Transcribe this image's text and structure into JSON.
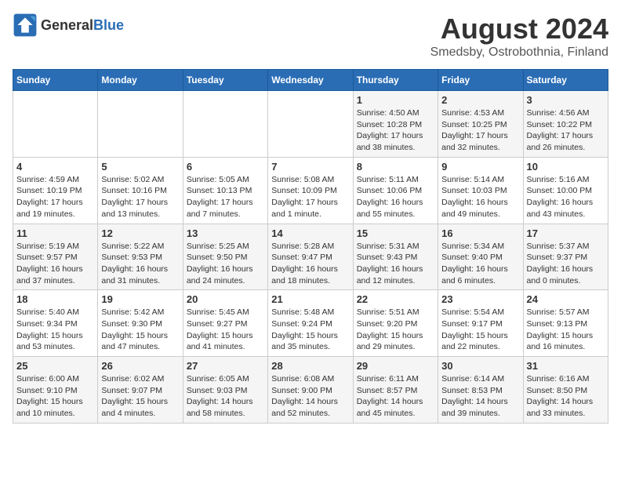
{
  "header": {
    "logo_general": "General",
    "logo_blue": "Blue",
    "title": "August 2024",
    "subtitle": "Smedsby, Ostrobothnia, Finland"
  },
  "days_of_week": [
    "Sunday",
    "Monday",
    "Tuesday",
    "Wednesday",
    "Thursday",
    "Friday",
    "Saturday"
  ],
  "weeks": [
    [
      {
        "day": "",
        "sunrise": "",
        "sunset": "",
        "daylight": ""
      },
      {
        "day": "",
        "sunrise": "",
        "sunset": "",
        "daylight": ""
      },
      {
        "day": "",
        "sunrise": "",
        "sunset": "",
        "daylight": ""
      },
      {
        "day": "",
        "sunrise": "",
        "sunset": "",
        "daylight": ""
      },
      {
        "day": "1",
        "sunrise": "Sunrise: 4:50 AM",
        "sunset": "Sunset: 10:28 PM",
        "daylight": "Daylight: 17 hours and 38 minutes."
      },
      {
        "day": "2",
        "sunrise": "Sunrise: 4:53 AM",
        "sunset": "Sunset: 10:25 PM",
        "daylight": "Daylight: 17 hours and 32 minutes."
      },
      {
        "day": "3",
        "sunrise": "Sunrise: 4:56 AM",
        "sunset": "Sunset: 10:22 PM",
        "daylight": "Daylight: 17 hours and 26 minutes."
      }
    ],
    [
      {
        "day": "4",
        "sunrise": "Sunrise: 4:59 AM",
        "sunset": "Sunset: 10:19 PM",
        "daylight": "Daylight: 17 hours and 19 minutes."
      },
      {
        "day": "5",
        "sunrise": "Sunrise: 5:02 AM",
        "sunset": "Sunset: 10:16 PM",
        "daylight": "Daylight: 17 hours and 13 minutes."
      },
      {
        "day": "6",
        "sunrise": "Sunrise: 5:05 AM",
        "sunset": "Sunset: 10:13 PM",
        "daylight": "Daylight: 17 hours and 7 minutes."
      },
      {
        "day": "7",
        "sunrise": "Sunrise: 5:08 AM",
        "sunset": "Sunset: 10:09 PM",
        "daylight": "Daylight: 17 hours and 1 minute."
      },
      {
        "day": "8",
        "sunrise": "Sunrise: 5:11 AM",
        "sunset": "Sunset: 10:06 PM",
        "daylight": "Daylight: 16 hours and 55 minutes."
      },
      {
        "day": "9",
        "sunrise": "Sunrise: 5:14 AM",
        "sunset": "Sunset: 10:03 PM",
        "daylight": "Daylight: 16 hours and 49 minutes."
      },
      {
        "day": "10",
        "sunrise": "Sunrise: 5:16 AM",
        "sunset": "Sunset: 10:00 PM",
        "daylight": "Daylight: 16 hours and 43 minutes."
      }
    ],
    [
      {
        "day": "11",
        "sunrise": "Sunrise: 5:19 AM",
        "sunset": "Sunset: 9:57 PM",
        "daylight": "Daylight: 16 hours and 37 minutes."
      },
      {
        "day": "12",
        "sunrise": "Sunrise: 5:22 AM",
        "sunset": "Sunset: 9:53 PM",
        "daylight": "Daylight: 16 hours and 31 minutes."
      },
      {
        "day": "13",
        "sunrise": "Sunrise: 5:25 AM",
        "sunset": "Sunset: 9:50 PM",
        "daylight": "Daylight: 16 hours and 24 minutes."
      },
      {
        "day": "14",
        "sunrise": "Sunrise: 5:28 AM",
        "sunset": "Sunset: 9:47 PM",
        "daylight": "Daylight: 16 hours and 18 minutes."
      },
      {
        "day": "15",
        "sunrise": "Sunrise: 5:31 AM",
        "sunset": "Sunset: 9:43 PM",
        "daylight": "Daylight: 16 hours and 12 minutes."
      },
      {
        "day": "16",
        "sunrise": "Sunrise: 5:34 AM",
        "sunset": "Sunset: 9:40 PM",
        "daylight": "Daylight: 16 hours and 6 minutes."
      },
      {
        "day": "17",
        "sunrise": "Sunrise: 5:37 AM",
        "sunset": "Sunset: 9:37 PM",
        "daylight": "Daylight: 16 hours and 0 minutes."
      }
    ],
    [
      {
        "day": "18",
        "sunrise": "Sunrise: 5:40 AM",
        "sunset": "Sunset: 9:34 PM",
        "daylight": "Daylight: 15 hours and 53 minutes."
      },
      {
        "day": "19",
        "sunrise": "Sunrise: 5:42 AM",
        "sunset": "Sunset: 9:30 PM",
        "daylight": "Daylight: 15 hours and 47 minutes."
      },
      {
        "day": "20",
        "sunrise": "Sunrise: 5:45 AM",
        "sunset": "Sunset: 9:27 PM",
        "daylight": "Daylight: 15 hours and 41 minutes."
      },
      {
        "day": "21",
        "sunrise": "Sunrise: 5:48 AM",
        "sunset": "Sunset: 9:24 PM",
        "daylight": "Daylight: 15 hours and 35 minutes."
      },
      {
        "day": "22",
        "sunrise": "Sunrise: 5:51 AM",
        "sunset": "Sunset: 9:20 PM",
        "daylight": "Daylight: 15 hours and 29 minutes."
      },
      {
        "day": "23",
        "sunrise": "Sunrise: 5:54 AM",
        "sunset": "Sunset: 9:17 PM",
        "daylight": "Daylight: 15 hours and 22 minutes."
      },
      {
        "day": "24",
        "sunrise": "Sunrise: 5:57 AM",
        "sunset": "Sunset: 9:13 PM",
        "daylight": "Daylight: 15 hours and 16 minutes."
      }
    ],
    [
      {
        "day": "25",
        "sunrise": "Sunrise: 6:00 AM",
        "sunset": "Sunset: 9:10 PM",
        "daylight": "Daylight: 15 hours and 10 minutes."
      },
      {
        "day": "26",
        "sunrise": "Sunrise: 6:02 AM",
        "sunset": "Sunset: 9:07 PM",
        "daylight": "Daylight: 15 hours and 4 minutes."
      },
      {
        "day": "27",
        "sunrise": "Sunrise: 6:05 AM",
        "sunset": "Sunset: 9:03 PM",
        "daylight": "Daylight: 14 hours and 58 minutes."
      },
      {
        "day": "28",
        "sunrise": "Sunrise: 6:08 AM",
        "sunset": "Sunset: 9:00 PM",
        "daylight": "Daylight: 14 hours and 52 minutes."
      },
      {
        "day": "29",
        "sunrise": "Sunrise: 6:11 AM",
        "sunset": "Sunset: 8:57 PM",
        "daylight": "Daylight: 14 hours and 45 minutes."
      },
      {
        "day": "30",
        "sunrise": "Sunrise: 6:14 AM",
        "sunset": "Sunset: 8:53 PM",
        "daylight": "Daylight: 14 hours and 39 minutes."
      },
      {
        "day": "31",
        "sunrise": "Sunrise: 6:16 AM",
        "sunset": "Sunset: 8:50 PM",
        "daylight": "Daylight: 14 hours and 33 minutes."
      }
    ]
  ]
}
